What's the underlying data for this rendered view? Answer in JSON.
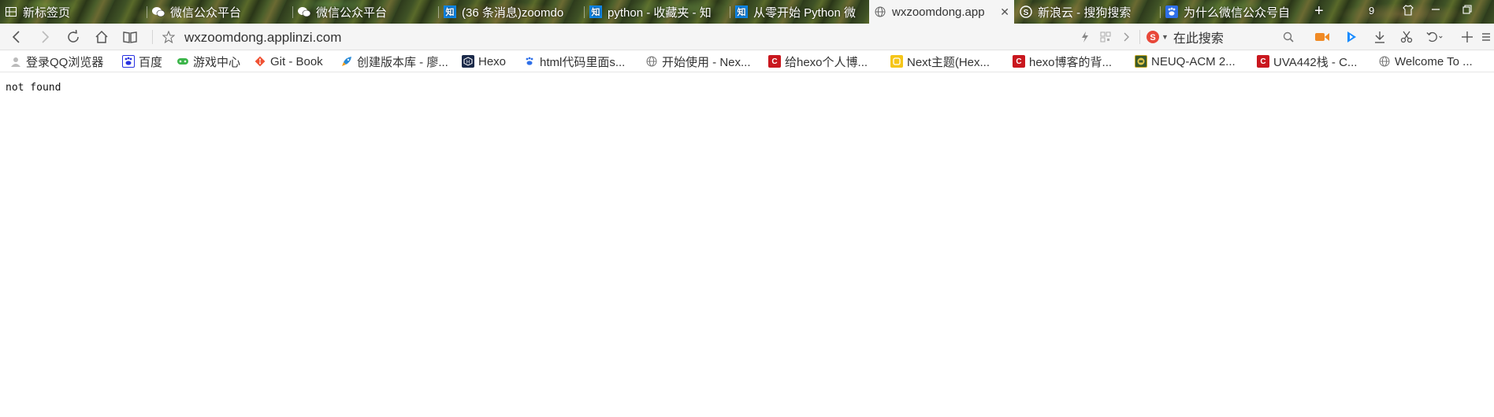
{
  "tabs": [
    {
      "title": "新标签页",
      "icon": "grid-icon",
      "active": false
    },
    {
      "title": "微信公众平台",
      "icon": "wechat-icon",
      "active": false
    },
    {
      "title": "微信公众平台",
      "icon": "wechat-icon",
      "active": false
    },
    {
      "title": "(36 条消息)zoomdo",
      "icon": "zhihu-icon",
      "active": false
    },
    {
      "title": "python - 收藏夹 - 知",
      "icon": "zhihu-icon",
      "active": false
    },
    {
      "title": "从零开始 Python 微",
      "icon": "zhihu-icon",
      "active": false
    },
    {
      "title": "wxzoomdong.app",
      "icon": "globe-icon",
      "active": true
    },
    {
      "title": "新浪云 - 搜狗搜索",
      "icon": "sogou-icon",
      "active": false
    },
    {
      "title": "为什么微信公众号自",
      "icon": "baidu-icon",
      "active": false
    }
  ],
  "tab_count": "9",
  "address": {
    "url": "wxzoomdong.applinzi.com"
  },
  "search": {
    "placeholder": "在此搜索"
  },
  "bookmarks": [
    {
      "label": "登录QQ浏览器",
      "icon": "user-icon"
    },
    {
      "label": "百度",
      "icon": "baidu-icon"
    },
    {
      "label": "游戏中心",
      "icon": "gamepad-icon"
    },
    {
      "label": "Git - Book",
      "icon": "git-icon"
    },
    {
      "label": "创建版本库 - 廖...",
      "icon": "rocket-icon"
    },
    {
      "label": "Hexo",
      "icon": "hexo-icon"
    },
    {
      "label": "html代码里面s...",
      "icon": "baidu-paw-icon"
    },
    {
      "label": "开始使用 - Nex...",
      "icon": "globe-icon"
    },
    {
      "label": "给hexo个人博...",
      "icon": "csdn-icon"
    },
    {
      "label": "Next主题(Hex...",
      "icon": "jianshu-icon"
    },
    {
      "label": "hexo博客的背...",
      "icon": "csdn-icon"
    },
    {
      "label": "NEUQ-ACM 2...",
      "icon": "neuq-icon"
    },
    {
      "label": "UVA442栈 - C...",
      "icon": "csdn-icon"
    },
    {
      "label": "Welcome To ...",
      "icon": "globe-icon"
    }
  ],
  "page": {
    "body_text": "not found"
  }
}
